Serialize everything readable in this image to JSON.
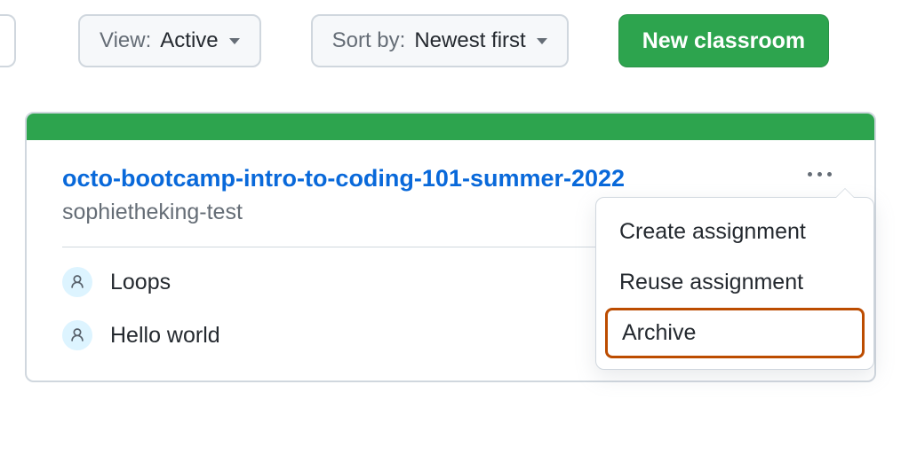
{
  "toolbar": {
    "view": {
      "prefix": "View:",
      "value": "Active"
    },
    "sort": {
      "prefix": "Sort by:",
      "value": "Newest first"
    },
    "new_button": "New classroom"
  },
  "classroom": {
    "title": "octo-bootcamp-intro-to-coding-101-summer-2022",
    "organization": "sophietheking-test",
    "assignments": [
      {
        "name": "Loops"
      },
      {
        "name": "Hello world"
      }
    ]
  },
  "menu": {
    "items": [
      {
        "label": "Create assignment",
        "highlight": false
      },
      {
        "label": "Reuse assignment",
        "highlight": false
      },
      {
        "label": "Archive",
        "highlight": true
      }
    ]
  }
}
